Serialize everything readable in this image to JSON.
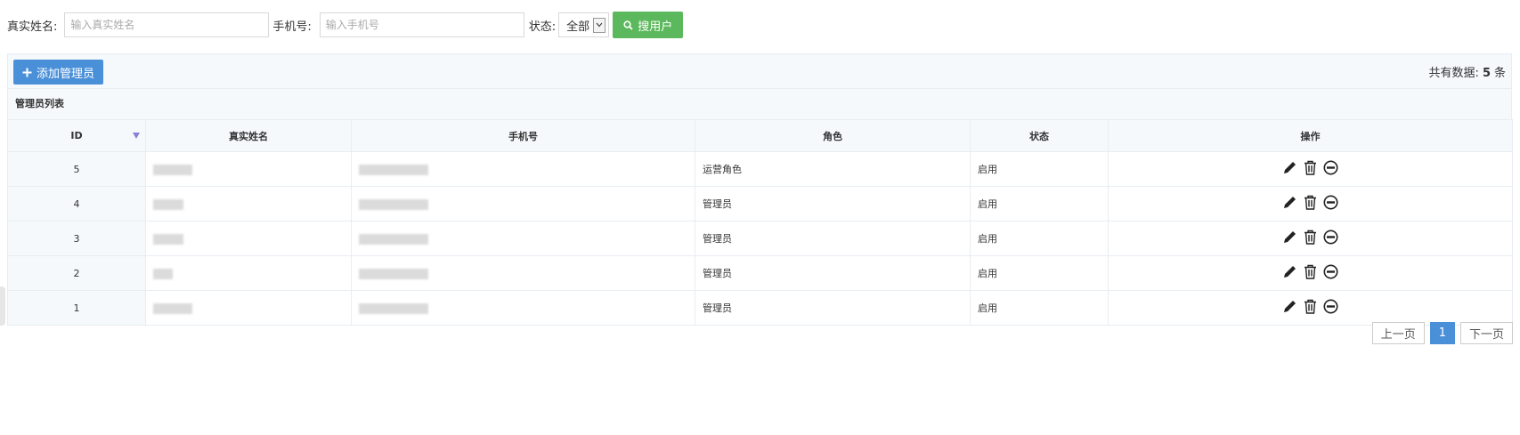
{
  "filters": {
    "name_label": "真实姓名:",
    "name_placeholder": "输入真实姓名",
    "phone_label": "手机号:",
    "phone_placeholder": "输入手机号",
    "status_label": "状态:",
    "status_value": "全部",
    "search_button": "搜用户"
  },
  "toolbar": {
    "add_button": "添加管理员",
    "total_prefix": "共有数据:",
    "total_count": "5",
    "total_suffix": "条"
  },
  "list": {
    "title": "管理员列表",
    "columns": [
      "ID",
      "真实姓名",
      "手机号",
      "角色",
      "状态",
      "操作"
    ],
    "rows": [
      {
        "id": "5",
        "role": "运营角色",
        "status": "启用"
      },
      {
        "id": "4",
        "role": "管理员",
        "status": "启用"
      },
      {
        "id": "3",
        "role": "管理员",
        "status": "启用"
      },
      {
        "id": "2",
        "role": "管理员",
        "status": "启用"
      },
      {
        "id": "1",
        "role": "管理员",
        "status": "启用"
      }
    ]
  },
  "pagination": {
    "prev": "上一页",
    "current": "1",
    "next": "下一页"
  },
  "icons": [
    "plus-icon",
    "search-icon",
    "sort-desc-icon",
    "edit-icon",
    "trash-icon",
    "disable-icon"
  ],
  "colors": {
    "primary": "#4a90d9",
    "success": "#5cb85c",
    "header_bg": "#f5f9fc"
  }
}
